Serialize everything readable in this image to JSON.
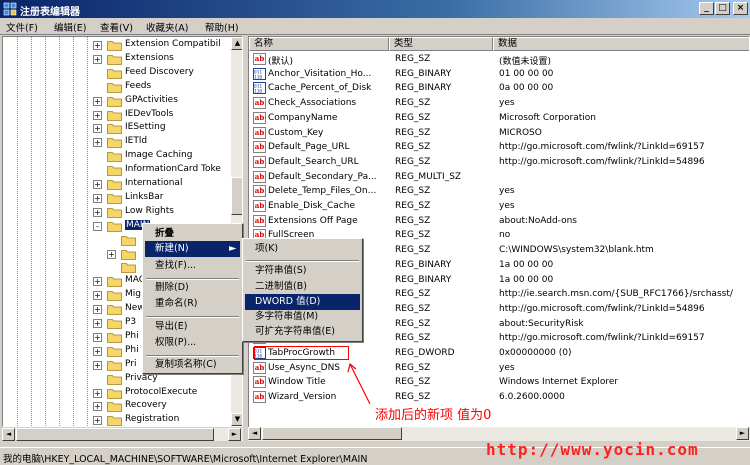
{
  "window": {
    "title": "注册表编辑器",
    "min": "_",
    "max": "□",
    "close": "×"
  },
  "menubar": [
    "文件(F)",
    "编辑(E)",
    "查看(V)",
    "收藏夹(A)",
    "帮助(H)"
  ],
  "tree": {
    "items": [
      {
        "label": "Extension Compatibil",
        "exp": "+"
      },
      {
        "label": "Extensions",
        "exp": "+"
      },
      {
        "label": "Feed Discovery",
        "exp": ""
      },
      {
        "label": "Feeds",
        "exp": ""
      },
      {
        "label": "GPActivities",
        "exp": "+"
      },
      {
        "label": "IEDevTools",
        "exp": "+"
      },
      {
        "label": "IESetting",
        "exp": "+"
      },
      {
        "label": "IETld",
        "exp": "+"
      },
      {
        "label": "Image Caching",
        "exp": ""
      },
      {
        "label": "InformationCard Toke",
        "exp": ""
      },
      {
        "label": "International",
        "exp": "+"
      },
      {
        "label": "LinksBar",
        "exp": "+"
      },
      {
        "label": "Low Rights",
        "exp": "+"
      },
      {
        "label": "MAIN",
        "exp": "-"
      },
      {
        "label": "",
        "exp": ""
      },
      {
        "label": "",
        "exp": "+"
      },
      {
        "label": "",
        "exp": ""
      },
      {
        "label": "MAO",
        "exp": "+"
      },
      {
        "label": "Mig",
        "exp": "+"
      },
      {
        "label": "New",
        "exp": "+"
      },
      {
        "label": "P3",
        "exp": "+"
      },
      {
        "label": "Phi",
        "exp": "+"
      },
      {
        "label": "Phi",
        "exp": "+"
      },
      {
        "label": "Pri",
        "exp": "+"
      },
      {
        "label": "Privacy",
        "exp": ""
      },
      {
        "label": "ProtocolExecute",
        "exp": "+"
      },
      {
        "label": "Recovery",
        "exp": "+"
      },
      {
        "label": "Registration",
        "exp": "+"
      }
    ]
  },
  "values": {
    "headers": {
      "name": "名称",
      "type": "类型",
      "data": "数据"
    },
    "rows": [
      {
        "name": "(默认)",
        "type": "REG_SZ",
        "data": "(数值未设置)",
        "icon": "ab"
      },
      {
        "name": "Anchor_Visitation_Ho...",
        "type": "REG_BINARY",
        "data": "01 00 00 00",
        "icon": "bin"
      },
      {
        "name": "Cache_Percent_of_Disk",
        "type": "REG_BINARY",
        "data": "0a 00 00 00",
        "icon": "bin"
      },
      {
        "name": "Check_Associations",
        "type": "REG_SZ",
        "data": "yes",
        "icon": "ab"
      },
      {
        "name": "CompanyName",
        "type": "REG_SZ",
        "data": "Microsoft Corporation",
        "icon": "ab"
      },
      {
        "name": "Custom_Key",
        "type": "REG_SZ",
        "data": "MICROSO",
        "icon": "ab"
      },
      {
        "name": "Default_Page_URL",
        "type": "REG_SZ",
        "data": "http://go.microsoft.com/fwlink/?LinkId=69157",
        "icon": "ab"
      },
      {
        "name": "Default_Search_URL",
        "type": "REG_SZ",
        "data": "http://go.microsoft.com/fwlink/?LinkId=54896",
        "icon": "ab"
      },
      {
        "name": "Default_Secondary_Pa...",
        "type": "REG_MULTI_SZ",
        "data": "",
        "icon": "ab"
      },
      {
        "name": "Delete_Temp_Files_On...",
        "type": "REG_SZ",
        "data": "yes",
        "icon": "ab"
      },
      {
        "name": "Enable_Disk_Cache",
        "type": "REG_SZ",
        "data": "yes",
        "icon": "ab"
      },
      {
        "name": "Extensions Off Page",
        "type": "REG_SZ",
        "data": "about:NoAdd-ons",
        "icon": "ab"
      },
      {
        "name": "FullScreen",
        "type": "REG_SZ",
        "data": "no",
        "icon": "ab"
      },
      {
        "name": "",
        "type": "REG_SZ",
        "data": "C:\\WINDOWS\\system32\\blank.htm",
        "icon": "ab"
      },
      {
        "name": "",
        "type": "REG_BINARY",
        "data": "1a 00 00 00",
        "icon": "bin"
      },
      {
        "name": "",
        "type": "REG_BINARY",
        "data": "1a 00 00 00",
        "icon": "bin"
      },
      {
        "name": "",
        "type": "REG_SZ",
        "data": "http://ie.search.msn.com/{SUB_RFC1766}/srchasst/",
        "icon": "ab"
      },
      {
        "name": "",
        "type": "REG_SZ",
        "data": "http://go.microsoft.com/fwlink/?LinkId=54896",
        "icon": "ab"
      },
      {
        "name": "",
        "type": "REG_SZ",
        "data": "about:SecurityRisk",
        "icon": "ab"
      },
      {
        "name": "",
        "type": "REG_SZ",
        "data": "http://go.microsoft.com/fwlink/?LinkId=69157",
        "icon": "ab"
      },
      {
        "name": "TabProcGrowth",
        "type": "REG_DWORD",
        "data": "0x00000000 (0)",
        "icon": "bin"
      },
      {
        "name": "Use_Async_DNS",
        "type": "REG_SZ",
        "data": "yes",
        "icon": "ab"
      },
      {
        "name": "Window Title",
        "type": "REG_SZ",
        "data": "Windows Internet Explorer",
        "icon": "ab"
      },
      {
        "name": "Wizard_Version",
        "type": "REG_SZ",
        "data": "6.0.2600.0000",
        "icon": "ab"
      }
    ]
  },
  "context_menu": {
    "items": [
      "折叠",
      "新建(N)",
      "查找(F)...",
      "删除(D)",
      "重命名(R)",
      "导出(E)",
      "权限(P)...",
      "复制项名称(C)"
    ]
  },
  "submenu": {
    "items": [
      "项(K)",
      "字符串值(S)",
      "二进制值(B)",
      "DWORD 值(D)",
      "多字符串值(M)",
      "可扩充字符串值(E)"
    ]
  },
  "status": "我的电脑\\HKEY_LOCAL_MACHINE\\SOFTWARE\\Microsoft\\Internet Explorer\\MAIN",
  "annotation": "添加后的新项 值为0",
  "watermark": "http://www.yocin.com",
  "colors": {
    "title_start": "#0a246a",
    "selection": "#0a246a",
    "annotation": "#ff0000"
  }
}
